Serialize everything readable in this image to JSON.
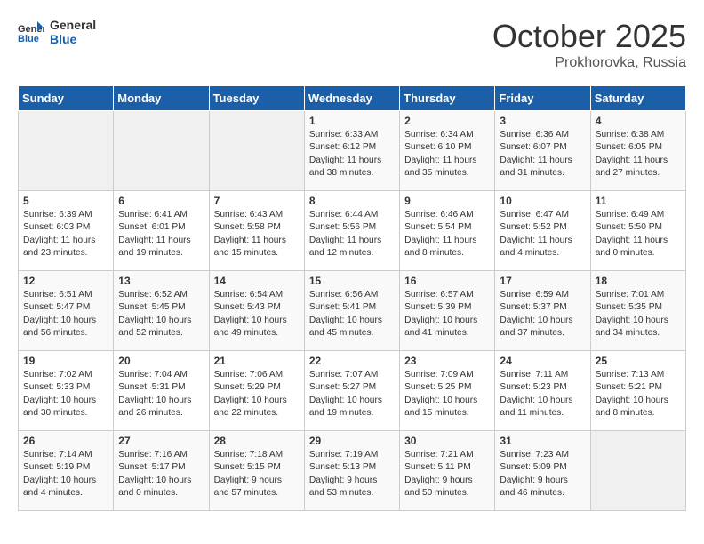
{
  "header": {
    "logo_line1": "General",
    "logo_line2": "Blue",
    "month": "October 2025",
    "location": "Prokhorovka, Russia"
  },
  "days_of_week": [
    "Sunday",
    "Monday",
    "Tuesday",
    "Wednesday",
    "Thursday",
    "Friday",
    "Saturday"
  ],
  "weeks": [
    [
      {
        "day": "",
        "info": ""
      },
      {
        "day": "",
        "info": ""
      },
      {
        "day": "",
        "info": ""
      },
      {
        "day": "1",
        "info": "Sunrise: 6:33 AM\nSunset: 6:12 PM\nDaylight: 11 hours\nand 38 minutes."
      },
      {
        "day": "2",
        "info": "Sunrise: 6:34 AM\nSunset: 6:10 PM\nDaylight: 11 hours\nand 35 minutes."
      },
      {
        "day": "3",
        "info": "Sunrise: 6:36 AM\nSunset: 6:07 PM\nDaylight: 11 hours\nand 31 minutes."
      },
      {
        "day": "4",
        "info": "Sunrise: 6:38 AM\nSunset: 6:05 PM\nDaylight: 11 hours\nand 27 minutes."
      }
    ],
    [
      {
        "day": "5",
        "info": "Sunrise: 6:39 AM\nSunset: 6:03 PM\nDaylight: 11 hours\nand 23 minutes."
      },
      {
        "day": "6",
        "info": "Sunrise: 6:41 AM\nSunset: 6:01 PM\nDaylight: 11 hours\nand 19 minutes."
      },
      {
        "day": "7",
        "info": "Sunrise: 6:43 AM\nSunset: 5:58 PM\nDaylight: 11 hours\nand 15 minutes."
      },
      {
        "day": "8",
        "info": "Sunrise: 6:44 AM\nSunset: 5:56 PM\nDaylight: 11 hours\nand 12 minutes."
      },
      {
        "day": "9",
        "info": "Sunrise: 6:46 AM\nSunset: 5:54 PM\nDaylight: 11 hours\nand 8 minutes."
      },
      {
        "day": "10",
        "info": "Sunrise: 6:47 AM\nSunset: 5:52 PM\nDaylight: 11 hours\nand 4 minutes."
      },
      {
        "day": "11",
        "info": "Sunrise: 6:49 AM\nSunset: 5:50 PM\nDaylight: 11 hours\nand 0 minutes."
      }
    ],
    [
      {
        "day": "12",
        "info": "Sunrise: 6:51 AM\nSunset: 5:47 PM\nDaylight: 10 hours\nand 56 minutes."
      },
      {
        "day": "13",
        "info": "Sunrise: 6:52 AM\nSunset: 5:45 PM\nDaylight: 10 hours\nand 52 minutes."
      },
      {
        "day": "14",
        "info": "Sunrise: 6:54 AM\nSunset: 5:43 PM\nDaylight: 10 hours\nand 49 minutes."
      },
      {
        "day": "15",
        "info": "Sunrise: 6:56 AM\nSunset: 5:41 PM\nDaylight: 10 hours\nand 45 minutes."
      },
      {
        "day": "16",
        "info": "Sunrise: 6:57 AM\nSunset: 5:39 PM\nDaylight: 10 hours\nand 41 minutes."
      },
      {
        "day": "17",
        "info": "Sunrise: 6:59 AM\nSunset: 5:37 PM\nDaylight: 10 hours\nand 37 minutes."
      },
      {
        "day": "18",
        "info": "Sunrise: 7:01 AM\nSunset: 5:35 PM\nDaylight: 10 hours\nand 34 minutes."
      }
    ],
    [
      {
        "day": "19",
        "info": "Sunrise: 7:02 AM\nSunset: 5:33 PM\nDaylight: 10 hours\nand 30 minutes."
      },
      {
        "day": "20",
        "info": "Sunrise: 7:04 AM\nSunset: 5:31 PM\nDaylight: 10 hours\nand 26 minutes."
      },
      {
        "day": "21",
        "info": "Sunrise: 7:06 AM\nSunset: 5:29 PM\nDaylight: 10 hours\nand 22 minutes."
      },
      {
        "day": "22",
        "info": "Sunrise: 7:07 AM\nSunset: 5:27 PM\nDaylight: 10 hours\nand 19 minutes."
      },
      {
        "day": "23",
        "info": "Sunrise: 7:09 AM\nSunset: 5:25 PM\nDaylight: 10 hours\nand 15 minutes."
      },
      {
        "day": "24",
        "info": "Sunrise: 7:11 AM\nSunset: 5:23 PM\nDaylight: 10 hours\nand 11 minutes."
      },
      {
        "day": "25",
        "info": "Sunrise: 7:13 AM\nSunset: 5:21 PM\nDaylight: 10 hours\nand 8 minutes."
      }
    ],
    [
      {
        "day": "26",
        "info": "Sunrise: 7:14 AM\nSunset: 5:19 PM\nDaylight: 10 hours\nand 4 minutes."
      },
      {
        "day": "27",
        "info": "Sunrise: 7:16 AM\nSunset: 5:17 PM\nDaylight: 10 hours\nand 0 minutes."
      },
      {
        "day": "28",
        "info": "Sunrise: 7:18 AM\nSunset: 5:15 PM\nDaylight: 9 hours\nand 57 minutes."
      },
      {
        "day": "29",
        "info": "Sunrise: 7:19 AM\nSunset: 5:13 PM\nDaylight: 9 hours\nand 53 minutes."
      },
      {
        "day": "30",
        "info": "Sunrise: 7:21 AM\nSunset: 5:11 PM\nDaylight: 9 hours\nand 50 minutes."
      },
      {
        "day": "31",
        "info": "Sunrise: 7:23 AM\nSunset: 5:09 PM\nDaylight: 9 hours\nand 46 minutes."
      },
      {
        "day": "",
        "info": ""
      }
    ]
  ]
}
